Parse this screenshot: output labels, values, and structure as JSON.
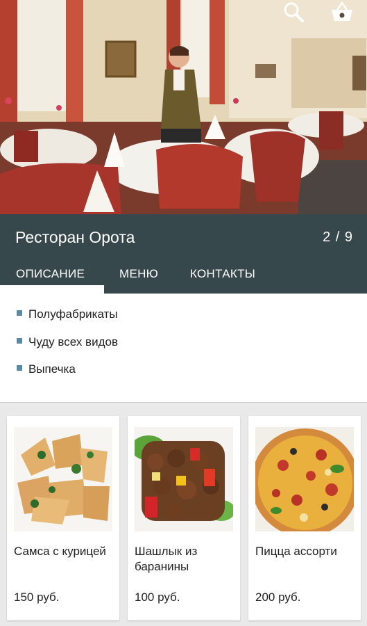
{
  "restaurant": {
    "title": "Ресторан Орота",
    "counter": "2 / 9"
  },
  "toolbar": {
    "icons": [
      "search-icon",
      "basket-icon"
    ]
  },
  "tabs": [
    {
      "label": "ОПИСАНИЕ",
      "active": true
    },
    {
      "label": "МЕНЮ",
      "active": false
    },
    {
      "label": "КОНТАКТЫ",
      "active": false
    }
  ],
  "description": {
    "items": [
      "Полуфабрикаты",
      "Чуду всех видов",
      "Выпечка"
    ]
  },
  "menu": [
    {
      "name": "Самса с курицей",
      "price": "150 руб."
    },
    {
      "name": "Шашлык из баранины",
      "price": "100 руб."
    },
    {
      "name": "Пицца ассорти",
      "price": "200 руб."
    }
  ],
  "colors": {
    "header": "#37484d",
    "bullet": "#5b8aa5"
  }
}
